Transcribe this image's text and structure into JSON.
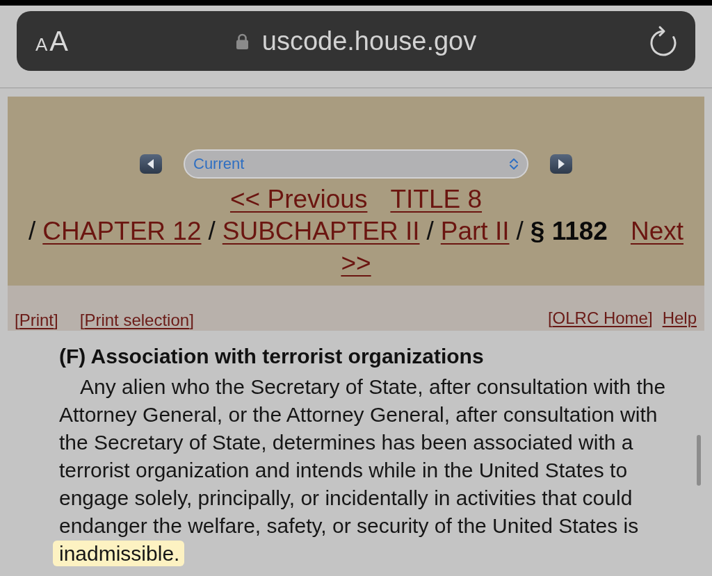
{
  "browser": {
    "text_size": {
      "small": "A",
      "large": "A"
    },
    "url": "uscode.house.gov"
  },
  "nav": {
    "select": {
      "value": "Current"
    },
    "lines": [
      [
        {
          "text": "<< Previous",
          "kind": "link"
        },
        {
          "text": "TITLE 8",
          "kind": "link"
        }
      ],
      [
        {
          "text": "/",
          "kind": "separator"
        },
        {
          "text": "CHAPTER 12",
          "kind": "link"
        },
        {
          "text": "/",
          "kind": "separator"
        },
        {
          "text": "SUBCHAPTER II",
          "kind": "link"
        },
        {
          "text": "/",
          "kind": "separator"
        },
        {
          "text": "Part II",
          "kind": "link"
        },
        {
          "text": "/",
          "kind": "separator"
        },
        {
          "text": "§ 1182",
          "kind": "current"
        },
        {
          "text": "Next",
          "kind": "link"
        }
      ],
      [
        {
          "text": ">>",
          "kind": "link"
        }
      ]
    ]
  },
  "link_bar": {
    "left": [
      {
        "prefix": "[",
        "label": "Print",
        "suffix": "]"
      },
      {
        "prefix": "[",
        "label": "Print selection",
        "suffix": "]"
      }
    ],
    "right": [
      {
        "prefix": "[",
        "label": "OLRC Home",
        "suffix": "]"
      },
      {
        "label": "Help"
      }
    ]
  },
  "section": {
    "heading": "(F) Association with terrorist organizations",
    "paragraph": [
      {
        "text": "Any alien who the Secretary of State, after consultation with the Attorney General, or the Attorney General, after consultation with the Secretary of State, determines has been associated with a terrorist organization and intends while in the United States to engage solely, principally, or incidentally in activities that could endanger the welfare, safety, or security of the United States is",
        "highlighted": false
      },
      {
        "text": "inadmissible.",
        "highlighted": true
      }
    ]
  }
}
